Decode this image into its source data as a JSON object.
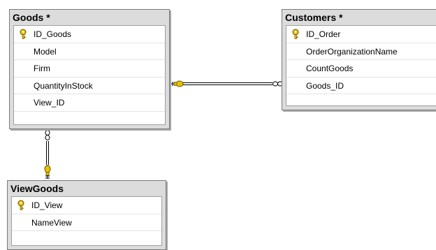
{
  "tables": {
    "goods": {
      "title": "Goods *",
      "columns": [
        "ID_Goods",
        "Model",
        "Firm",
        "QuantityInStock",
        "View_ID"
      ],
      "primary_key": "ID_Goods"
    },
    "customers": {
      "title": "Customers *",
      "columns": [
        "ID_Order",
        "OrderOrganizationName",
        "CountGoods",
        "Goods_ID"
      ],
      "primary_key": "ID_Order"
    },
    "viewgoods": {
      "title": "ViewGoods",
      "columns": [
        "ID_View",
        "NameView"
      ],
      "primary_key": "ID_View"
    }
  },
  "relationships": [
    {
      "from": "Goods",
      "from_end": "key",
      "to": "Customers",
      "to_end": "infinity"
    },
    {
      "from": "ViewGoods",
      "from_end": "key",
      "to": "Goods",
      "to_end": "infinity"
    }
  ],
  "colors": {
    "key_icon": "#e8c200",
    "line": "#000000",
    "title_bar": "#dcdcdc"
  }
}
